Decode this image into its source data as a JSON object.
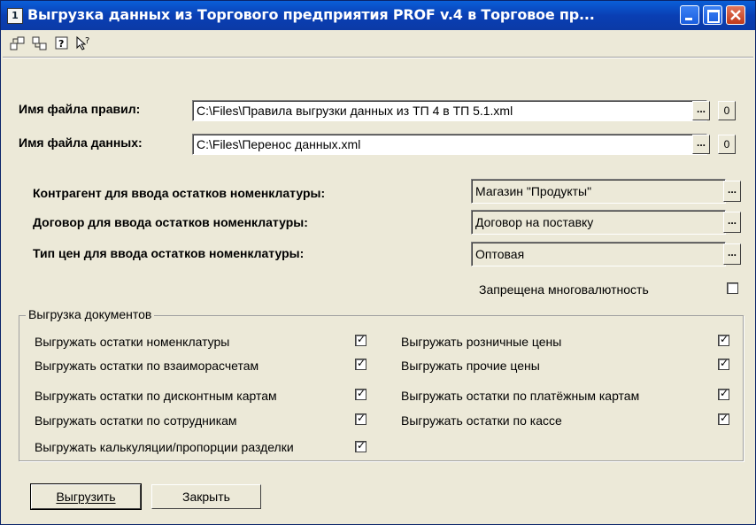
{
  "window": {
    "title": "Выгрузка данных из Торгового предприятия PROF v.4 в Торговое пр...",
    "app_icon": "1c-app-icon"
  },
  "toolbar": {
    "icons": [
      "export-settings-icon",
      "import-settings-icon",
      "help-icon",
      "context-help-icon"
    ]
  },
  "rules_file": {
    "label": "Имя файла правил:",
    "value": "C:\\Files\\Правила выгрузки данных из ТП 4 в ТП 5.1.xml",
    "browse": "...",
    "open": "0"
  },
  "data_file": {
    "label": "Имя файла данных:",
    "value": "C:\\Files\\Перенос данных.xml",
    "browse": "...",
    "open": "0"
  },
  "contragent": {
    "label": "Контрагент для ввода остатков номенклатуры:",
    "value": "Магазин \"Продукты\""
  },
  "contract": {
    "label": "Договор для ввода остатков номенклатуры:",
    "value": "Договор на поставку"
  },
  "price_type": {
    "label": "Тип цен для ввода остатков номенклатуры:",
    "value": "Оптовая"
  },
  "multicurrency": {
    "label": "Запрещена многовалютность",
    "checked": false
  },
  "export_group": {
    "title": "Выгрузка документов",
    "left": [
      {
        "label": "Выгружать остатки номенклатуры",
        "checked": true
      },
      {
        "label": "Выгружать остатки по взаиморасчетам",
        "checked": true
      },
      {
        "label": "Выгружать остатки по дисконтным картам",
        "checked": true
      },
      {
        "label": "Выгружать остатки по сотрудникам",
        "checked": true
      },
      {
        "label": "Выгружать калькуляции/пропорции разделки",
        "checked": true
      }
    ],
    "right": [
      {
        "label": "Выгружать розничные цены",
        "checked": true
      },
      {
        "label": "Выгружать прочие цены",
        "checked": true
      },
      {
        "label": "Выгружать остатки по платёжным картам",
        "checked": true
      },
      {
        "label": "Выгружать остатки по кассе",
        "checked": true
      }
    ]
  },
  "buttons": {
    "export": "Выгрузить",
    "close": "Закрыть"
  }
}
